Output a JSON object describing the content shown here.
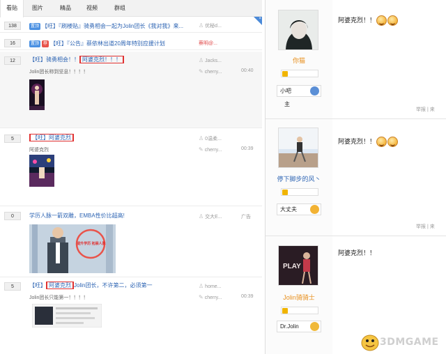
{
  "tabs": [
    "看贴",
    "图片",
    "精品",
    "视频",
    "群组"
  ],
  "threads": [
    {
      "count": "138",
      "tags": [
        {
          "text": "置顶",
          "color": "blue"
        }
      ],
      "title": "【旺】『刷楼贴』骑勇相会一起为Jolin团长《我对我》来...",
      "author": "优秘d...",
      "time": ""
    },
    {
      "count": "16",
      "tags": [
        {
          "text": "置顶",
          "color": "blue"
        },
        {
          "text": "荐",
          "color": "red"
        }
      ],
      "title": "【旺】『公告』蔡依林出道20周年特别应援计划",
      "author": "蔡明@...",
      "time": ""
    },
    {
      "count": "12",
      "title_pre": "【旺】骑勇相会！！",
      "title_boxed": "阿婆克烈！！！",
      "title_post": "",
      "snippet": "Jolin团长称到坚息！！！！",
      "author": "Jacks...",
      "last_reply": "cherry...",
      "time": "00:40"
    },
    {
      "count": "5",
      "title_pre": "",
      "title_boxed": "【旺】阿婆克烈",
      "title_post": "",
      "snippet": "阿婆克烈",
      "author": "0温柔...",
      "last_reply": "cherry...",
      "time": "00:39"
    },
    {
      "count": "0",
      "title": "学历人脉一箭双雕，EMBA性价比超高!",
      "author": "交大E...",
      "time": "广告",
      "ad_text": "提升学历 拓展人脉"
    },
    {
      "count": "5",
      "title_pre": "【旺】",
      "title_boxed": "阿婆克烈",
      "title_post": "Jolin团长，不许第二，必须第一",
      "snippet": "Jolin团长只能第一！！！！",
      "author": "home...",
      "last_reply": "cherry...",
      "time": "00:39"
    }
  ],
  "posts": [
    {
      "username": "你猫",
      "badge": "小吧",
      "badge2": "主",
      "text": "阿婆克烈！！",
      "report": "举报 | 来"
    },
    {
      "username": "停下脚步的风丶",
      "badge": "大丈夫",
      "text": "阿婆克烈！！",
      "report": "举报 | 来"
    },
    {
      "username": "Jolin骑骑士",
      "badge": "Dr.Jolin",
      "text": "阿婆克烈！！",
      "report": ""
    }
  ],
  "watermark": "3DMGAME",
  "colors": {
    "link": "#2d64b3",
    "highlight_box": "#e03131",
    "tab_bar": "#f2f2f2"
  }
}
